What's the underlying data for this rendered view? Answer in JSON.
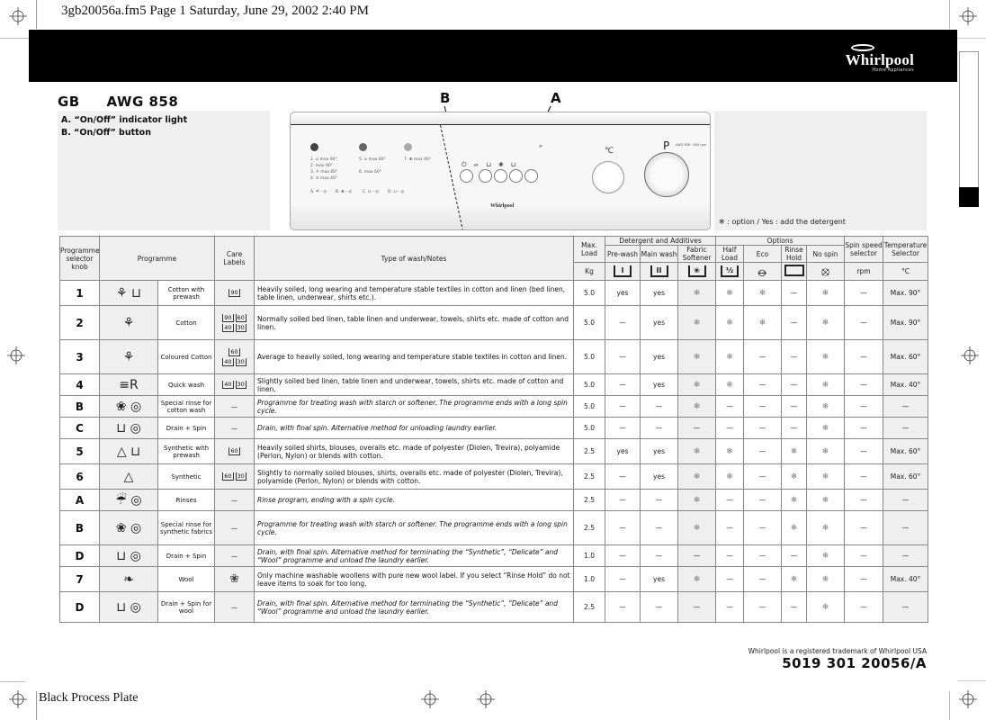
{
  "print_header": "3gb20056a.fm5  Page 1  Saturday, June 29, 2002  2:40 PM",
  "brand": {
    "logo": "Whirlpool",
    "logo_sub": "Home Appliances"
  },
  "model": {
    "country": "GB",
    "name": "AWG 858"
  },
  "legend": [
    "A. “On/Off” indicator light",
    "B. “On/Off” button"
  ],
  "callouts": {
    "a": "A",
    "b": "B"
  },
  "panel": {
    "legend_lines": [
      "1. ⊔ max 90°",
      "2.    max 90°",
      "3. ⚘ max 60°",
      "4. ≡ max 40°",
      "5. ⊔ max 60°",
      "6.    max 60°",
      "7. ❀ max 40°",
      "A. ☔ - ◎",
      "B. ❀ - ◎",
      "C. ⊔ - ◎",
      "D. ⊔ - ◎"
    ],
    "button_icons": [
      "⏻",
      "⦵",
      "⊔",
      "❀",
      "⊔"
    ],
    "logo": "Whirlpool",
    "temp_mark": "℃",
    "prog_mark": "P",
    "prog_caption": "AWG 858 · 800 rpm"
  },
  "note": "❄ : option / Yes : add the detergent",
  "table": {
    "headers": {
      "knob": "Programme selector knob",
      "programme": "Programme",
      "care": "Care Labels",
      "notes": "Type of wash/Notes",
      "load": "Max. Load",
      "load_unit": "Kg",
      "detergent_group": "Detergent and Additives",
      "prewash": "Pre-wash",
      "mainwash": "Main wash",
      "softener": "Fabric Softener",
      "options_group": "Options",
      "halfload": "Half Load",
      "eco": "Eco",
      "rinsehold": "Rinse Hold",
      "nospin": "No spin",
      "spin": "Spin speed selector",
      "spin_unit": "rpm",
      "temp": "Temperature Selector",
      "temp_unit": "°C"
    },
    "header_icons": {
      "prewash": "I",
      "mainwash": "II",
      "softener": "❀",
      "halfload": "½",
      "eco": "⦵",
      "rinsehold": "—",
      "nospin": "⦻"
    },
    "rows": [
      {
        "knob": "1",
        "icon": "⚘ ⊔",
        "name": "Cotton with prewash",
        "care": [
          "90"
        ],
        "notes": "Heavily soiled, long wearing and temperature stable textiles in cotton and linen (bed linen, table linen, underwear, shirts etc.).",
        "italic": false,
        "load": "5.0",
        "prewash": "yes",
        "mainwash": "yes",
        "softener": "❄",
        "halfload": "❄",
        "eco": "❄",
        "rinsehold": "—",
        "nospin": "❄",
        "spin": "—",
        "temp": "Max. 90°"
      },
      {
        "knob": "2",
        "icon": "⚘",
        "name": "Cotton",
        "care": [
          "90",
          "60",
          "40",
          "30"
        ],
        "notes": "Normally soiled bed linen, table linen and underwear, towels, shirts etc. made of cotton and linen.",
        "italic": false,
        "load": "5.0",
        "prewash": "—",
        "mainwash": "yes",
        "softener": "❄",
        "halfload": "❄",
        "eco": "❄",
        "rinsehold": "—",
        "nospin": "❄",
        "spin": "—",
        "temp": "Max. 90°"
      },
      {
        "knob": "3",
        "icon": "⚘",
        "name": "Coloured Cotton",
        "care": [
          "60",
          "40",
          "30"
        ],
        "notes": "Average to heavily soiled, long wearing and temperature stable textiles in cotton and linen.",
        "italic": false,
        "load": "5.0",
        "prewash": "—",
        "mainwash": "yes",
        "softener": "❄",
        "halfload": "❄",
        "eco": "—",
        "rinsehold": "—",
        "nospin": "❄",
        "spin": "—",
        "temp": "Max. 60°"
      },
      {
        "knob": "4",
        "icon": "≡R",
        "name": "Quick wash",
        "care": [
          "40",
          "30"
        ],
        "notes": "Slightly soiled bed linen, table linen and underwear, towels, shirts etc. made of cotton and linen.",
        "italic": false,
        "load": "5.0",
        "prewash": "—",
        "mainwash": "yes",
        "softener": "❄",
        "halfload": "❄",
        "eco": "—",
        "rinsehold": "—",
        "nospin": "❄",
        "spin": "—",
        "temp": "Max. 40°"
      },
      {
        "knob": "B",
        "icon": "❀ ◎",
        "name": "Special rinse for cotton wash",
        "care": [
          "—"
        ],
        "notes": "Programme for treating wash with starch or softener. The programme ends with a long spin cycle.",
        "italic": true,
        "load": "5.0",
        "prewash": "—",
        "mainwash": "—",
        "softener": "❄",
        "halfload": "—",
        "eco": "—",
        "rinsehold": "—",
        "nospin": "❄",
        "spin": "—",
        "temp": "—"
      },
      {
        "knob": "C",
        "icon": "⊔ ◎",
        "name": "Drain + Spin",
        "care": [
          "—"
        ],
        "notes": "Drain, with final spin. Alternative method for unloading laundry earlier.",
        "italic": true,
        "load": "5.0",
        "prewash": "—",
        "mainwash": "—",
        "softener": "—",
        "halfload": "—",
        "eco": "—",
        "rinsehold": "—",
        "nospin": "❄",
        "spin": "—",
        "temp": "—"
      },
      {
        "knob": "5",
        "icon": "△ ⊔",
        "name": "Synthetic with prewash",
        "care": [
          "60"
        ],
        "notes": "Heavily soiled shirts, blouses, overalls etc. made of polyester (Diolen, Trevira), polyamide (Perlon, Nylon) or blends with cotton.",
        "italic": false,
        "load": "2.5",
        "prewash": "yes",
        "mainwash": "yes",
        "softener": "❄",
        "halfload": "❄",
        "eco": "—",
        "rinsehold": "❄",
        "nospin": "❄",
        "spin": "—",
        "temp": "Max. 60°"
      },
      {
        "knob": "6",
        "icon": "△",
        "name": "Synthetic",
        "care": [
          "60",
          "30"
        ],
        "notes": "Slightly to normally soiled blouses, shirts, overalls etc. made of polyester (Diolen, Trevira), polyamide (Perlon, Nylon) or blends with cotton.",
        "italic": false,
        "load": "2.5",
        "prewash": "—",
        "mainwash": "yes",
        "softener": "❄",
        "halfload": "❄",
        "eco": "—",
        "rinsehold": "❄",
        "nospin": "❄",
        "spin": "—",
        "temp": "Max. 60°"
      },
      {
        "knob": "A",
        "icon": "☔ ◎",
        "name": "Rinses",
        "care": [
          "—"
        ],
        "notes": "Rinse program, ending with a spin cycle.",
        "italic": true,
        "load": "2.5",
        "prewash": "—",
        "mainwash": "—",
        "softener": "❄",
        "halfload": "—",
        "eco": "—",
        "rinsehold": "❄",
        "nospin": "❄",
        "spin": "—",
        "temp": "—"
      },
      {
        "knob": "B",
        "icon": "❀ ◎",
        "name": "Special rinse for synthetic fabrics",
        "care": [
          "—"
        ],
        "notes": "Programme for treating wash with starch or softener. The programme ends with a long spin cycle.",
        "italic": true,
        "load": "2.5",
        "prewash": "—",
        "mainwash": "—",
        "softener": "❄",
        "halfload": "—",
        "eco": "—",
        "rinsehold": "❄",
        "nospin": "❄",
        "spin": "—",
        "temp": "—"
      },
      {
        "knob": "D",
        "icon": "⊔ ◎",
        "name": "Drain + Spin",
        "care": [
          "—"
        ],
        "notes": "Drain, with final spin. Alternative method for terminating the “Synthetic”, “Delicate” and “Wool” programme and unload the laundry earlier.",
        "italic": true,
        "load": "1.0",
        "prewash": "—",
        "mainwash": "—",
        "softener": "—",
        "halfload": "—",
        "eco": "—",
        "rinsehold": "—",
        "nospin": "❄",
        "spin": "—",
        "temp": "—"
      },
      {
        "knob": "7",
        "icon": "❧",
        "name": "Wool",
        "care": [
          "wool-ball"
        ],
        "notes": "Only machine washable woollens with pure new wool label. If you select “Rinse Hold” do not leave items to soak for too long.",
        "italic": false,
        "load": "1.0",
        "prewash": "—",
        "mainwash": "yes",
        "softener": "❄",
        "halfload": "—",
        "eco": "—",
        "rinsehold": "❄",
        "nospin": "❄",
        "spin": "—",
        "temp": "Max. 40°"
      },
      {
        "knob": "D",
        "icon": "⊔ ◎",
        "name": "Drain + Spin for wool",
        "care": [
          "—"
        ],
        "notes": "Drain, with final spin. Alternative method for terminating the “Synthetic”, “Delicate” and “Wool” programme and unload the laundry earlier.",
        "italic": true,
        "load": "2.5",
        "prewash": "—",
        "mainwash": "—",
        "softener": "—",
        "halfload": "—",
        "eco": "—",
        "rinsehold": "—",
        "nospin": "❄",
        "spin": "—",
        "temp": "—"
      }
    ]
  },
  "trademark": "Whirlpool is a registered trademark of Whirlpool USA",
  "part_number": "5019 301 20056/A",
  "footer": "Black Process Plate"
}
